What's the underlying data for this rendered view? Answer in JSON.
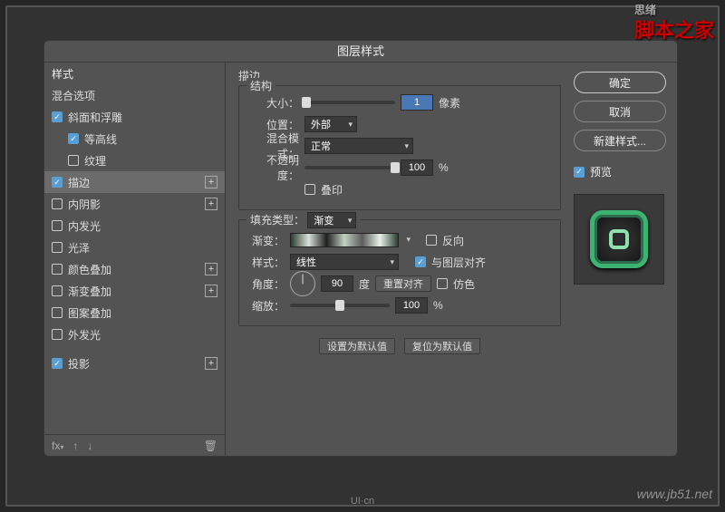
{
  "watermark_top": "脚本之家",
  "watermark_top_sub": "思绪",
  "watermark_bottom": "www.jb51.net",
  "logo_bottom": "UI·cn",
  "dialog": {
    "title": "图层样式"
  },
  "left": {
    "header": "样式",
    "blend": "混合选项",
    "items": [
      {
        "label": "斜面和浮雕",
        "checked": true,
        "plus": false
      },
      {
        "label": "等高线",
        "checked": true,
        "sub": true
      },
      {
        "label": "纹理",
        "checked": false,
        "sub": true
      },
      {
        "label": "描边",
        "checked": true,
        "plus": true,
        "selected": true
      },
      {
        "label": "内阴影",
        "checked": false,
        "plus": true
      },
      {
        "label": "内发光",
        "checked": false
      },
      {
        "label": "光泽",
        "checked": false
      },
      {
        "label": "颜色叠加",
        "checked": false,
        "plus": true
      },
      {
        "label": "渐变叠加",
        "checked": false,
        "plus": true
      },
      {
        "label": "图案叠加",
        "checked": false
      },
      {
        "label": "外发光",
        "checked": false
      },
      {
        "label": "投影",
        "checked": true,
        "plus": true
      }
    ],
    "fx": "fx"
  },
  "center": {
    "stroke_title": "描边",
    "structure_legend": "结构",
    "size_label": "大小：",
    "size_value": "1",
    "size_unit": "像素",
    "position_label": "位置：",
    "position_value": "外部",
    "blend_label": "混合模式：",
    "blend_value": "正常",
    "opacity_label": "不透明度：",
    "opacity_value": "100",
    "opacity_unit": "%",
    "overprint_label": "叠印",
    "filltype_label": "填充类型：",
    "filltype_value": "渐变",
    "gradient_label": "渐变：",
    "reverse_label": "反向",
    "style_label": "样式：",
    "style_value": "线性",
    "align_label": "与图层对齐",
    "angle_label": "角度：",
    "angle_value": "90",
    "angle_unit": "度",
    "reset_align": "重置对齐",
    "dither_label": "仿色",
    "scale_label": "缩放：",
    "scale_value": "100",
    "scale_unit": "%",
    "set_default": "设置为默认值",
    "reset_default": "复位为默认值"
  },
  "right": {
    "ok": "确定",
    "cancel": "取消",
    "new_style": "新建样式...",
    "preview": "预览"
  }
}
